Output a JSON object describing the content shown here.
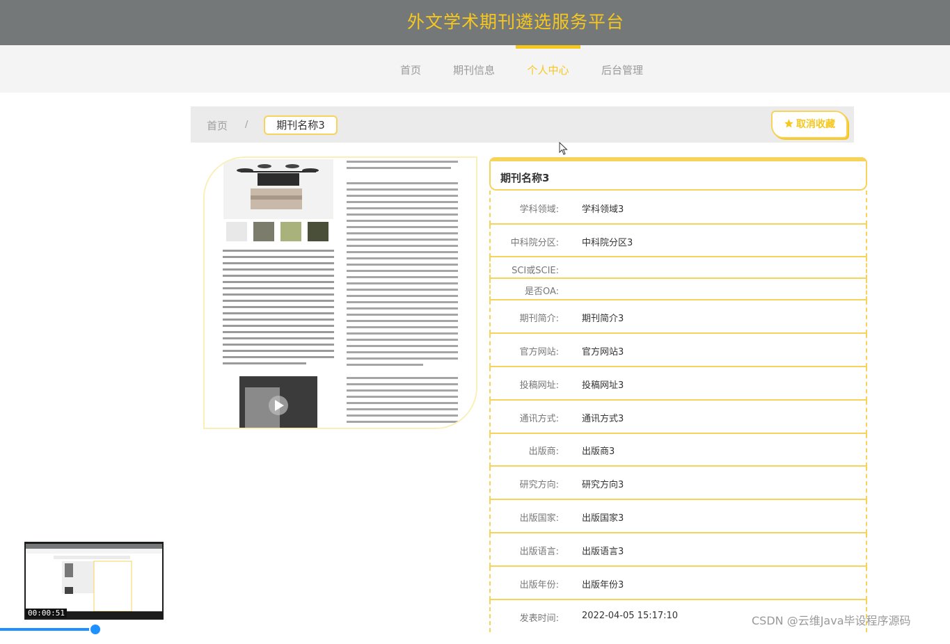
{
  "header": {
    "site_title": "外文学术期刊遴选服务平台"
  },
  "nav": {
    "items": [
      {
        "label": "首页"
      },
      {
        "label": "期刊信息"
      },
      {
        "label": "个人中心"
      },
      {
        "label": "后台管理"
      }
    ],
    "active": "个人中心"
  },
  "breadcrumb": {
    "home": "首页",
    "separator": "/",
    "current": "期刊名称3"
  },
  "actions": {
    "unfavorite_label": "取消收藏"
  },
  "detail": {
    "title": "期刊名称3",
    "fields": [
      {
        "label": "学科领域:",
        "value": "学科领域3"
      },
      {
        "label": "中科院分区:",
        "value": "中科院分区3"
      },
      {
        "label": "SCI或SCIE:",
        "value": ""
      },
      {
        "label": "是否OA:",
        "value": ""
      },
      {
        "label": "期刊简介:",
        "value": "期刊简介3"
      },
      {
        "label": "官方网站:",
        "value": "官方网站3"
      },
      {
        "label": "投稿网址:",
        "value": "投稿网址3"
      },
      {
        "label": "通讯方式:",
        "value": "通讯方式3"
      },
      {
        "label": "出版商:",
        "value": "出版商3"
      },
      {
        "label": "研究方向:",
        "value": "研究方向3"
      },
      {
        "label": "出版国家:",
        "value": "出版国家3"
      },
      {
        "label": "出版语言:",
        "value": "出版语言3"
      },
      {
        "label": "出版年份:",
        "value": "出版年份3"
      },
      {
        "label": "发表时间:",
        "value": "2022-04-05 15:17:10"
      }
    ]
  },
  "video": {
    "timestamp": "00:00:51",
    "progress": 0.1
  },
  "watermark": "CSDN @云维Java毕设程序源码",
  "colors": {
    "accent": "#f6c81f",
    "header_bg": "#757878",
    "nav_bg": "#f4f4f4",
    "border": "#f6d35a"
  }
}
